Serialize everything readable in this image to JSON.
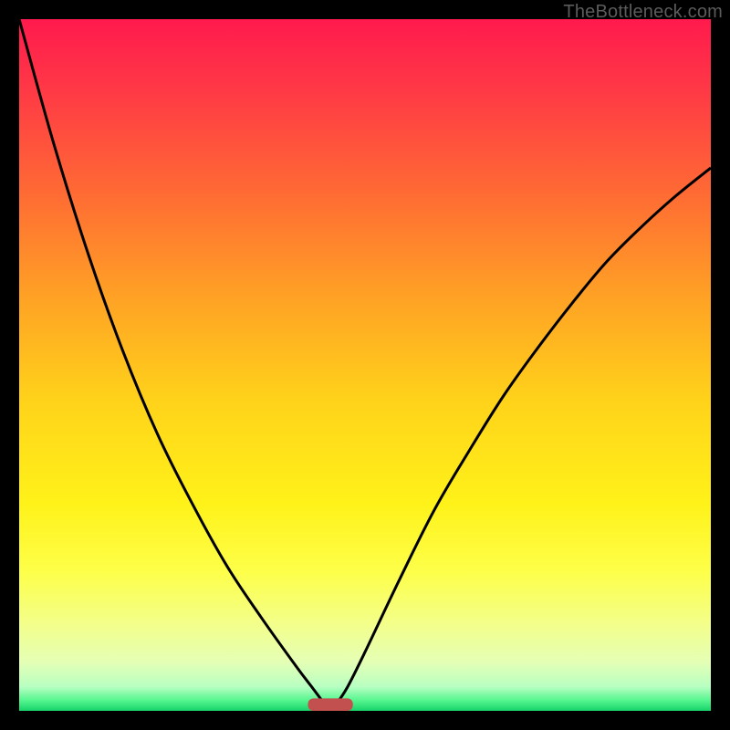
{
  "watermark": "TheBottleneck.com",
  "chart_data": {
    "type": "line",
    "title": "",
    "xlabel": "",
    "ylabel": "",
    "xlim": [
      0,
      1
    ],
    "ylim": [
      0,
      1
    ],
    "min_at_x": 0.45,
    "series": [
      {
        "name": "curve-left",
        "x": [
          0.0,
          0.05,
          0.1,
          0.15,
          0.2,
          0.25,
          0.3,
          0.35,
          0.4,
          0.425,
          0.44,
          0.45
        ],
        "y": [
          1.0,
          0.82,
          0.66,
          0.52,
          0.4,
          0.3,
          0.21,
          0.135,
          0.065,
          0.032,
          0.012,
          0.0
        ]
      },
      {
        "name": "curve-right",
        "x": [
          0.45,
          0.46,
          0.475,
          0.5,
          0.55,
          0.6,
          0.65,
          0.7,
          0.75,
          0.8,
          0.85,
          0.9,
          0.95,
          1.0
        ],
        "y": [
          0.0,
          0.012,
          0.035,
          0.085,
          0.19,
          0.29,
          0.375,
          0.455,
          0.525,
          0.59,
          0.65,
          0.7,
          0.745,
          0.785
        ]
      }
    ],
    "gradient_stops": [
      {
        "offset": 0.0,
        "color": "#ff1a4d"
      },
      {
        "offset": 0.1,
        "color": "#ff3846"
      },
      {
        "offset": 0.25,
        "color": "#ff6a34"
      },
      {
        "offset": 0.4,
        "color": "#ffa125"
      },
      {
        "offset": 0.55,
        "color": "#ffd21a"
      },
      {
        "offset": 0.7,
        "color": "#fff219"
      },
      {
        "offset": 0.8,
        "color": "#fdff4a"
      },
      {
        "offset": 0.88,
        "color": "#f2ff8f"
      },
      {
        "offset": 0.93,
        "color": "#e4ffb5"
      },
      {
        "offset": 0.965,
        "color": "#b8ffc2"
      },
      {
        "offset": 0.985,
        "color": "#55f58e"
      },
      {
        "offset": 1.0,
        "color": "#17d36a"
      }
    ],
    "marker": {
      "x": 0.45,
      "y": 0.0,
      "width_frac": 0.065,
      "height_frac": 0.018,
      "color": "#c1504f"
    }
  }
}
